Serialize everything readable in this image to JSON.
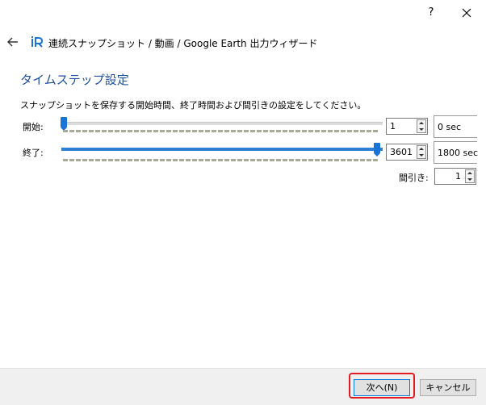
{
  "titlebar": {
    "help_label": "?",
    "close_icon": "close-icon"
  },
  "header": {
    "back_icon": "back-arrow-icon",
    "app_icon": "qgis-plugin-icon",
    "breadcrumb": "連続スナップショット / 動画 / Google Earth 出力ウィザード"
  },
  "page": {
    "title": "タイムステップ設定",
    "description": "スナップショットを保存する開始時間、終了時間および間引きの設定をしてください。"
  },
  "start": {
    "label": "開始:",
    "slider_fraction": 0.0,
    "value": "1",
    "seconds": "0 sec"
  },
  "end": {
    "label": "終了:",
    "slider_fraction": 1.0,
    "value": "3601",
    "seconds": "1800 sec"
  },
  "interval": {
    "label": "間引き:",
    "value": "1"
  },
  "footer": {
    "next_label": "次へ(N)",
    "cancel_label": "キャンセル"
  },
  "colors": {
    "title": "#1e4f9c",
    "slider_thumb": "#1a73d6",
    "highlight": "#e31b23"
  }
}
